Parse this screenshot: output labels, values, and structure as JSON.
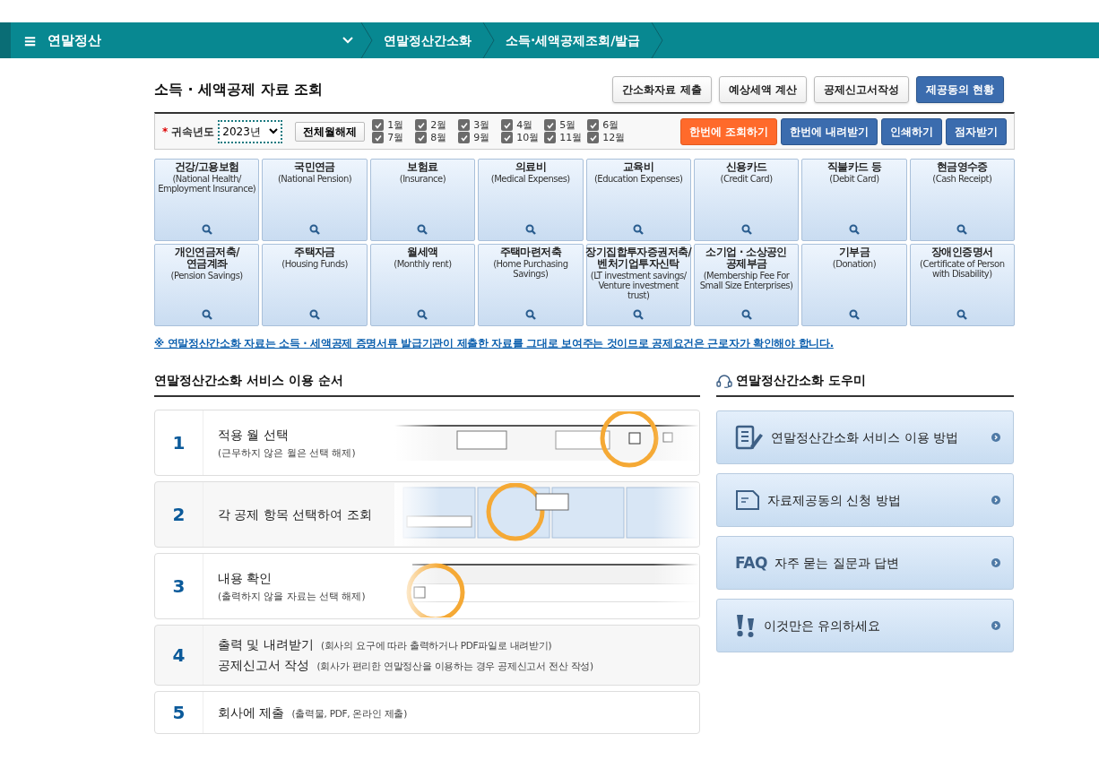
{
  "nav": {
    "menu_icon": "≡",
    "title": "연말정산",
    "crumbs": [
      "연말정산간소화",
      "소득·세액공제조회/발급"
    ]
  },
  "page_title": "소득 · 세액공제 자료 조회",
  "top_buttons": [
    {
      "label": "간소화자료 제출",
      "kind": "plain"
    },
    {
      "label": "예상세액 계산",
      "kind": "plain"
    },
    {
      "label": "공제신고서작성",
      "kind": "plain"
    },
    {
      "label": "제공동의 현황",
      "kind": "primary"
    }
  ],
  "filter": {
    "required_mark": "*",
    "year_label": "귀속년도",
    "year_value": "2023년",
    "clear_button": "전체월해제",
    "months": [
      {
        "label": "1월",
        "checked": true
      },
      {
        "label": "2월",
        "checked": true
      },
      {
        "label": "3월",
        "checked": true
      },
      {
        "label": "4월",
        "checked": true
      },
      {
        "label": "5월",
        "checked": true
      },
      {
        "label": "6월",
        "checked": true
      },
      {
        "label": "7월",
        "checked": true
      },
      {
        "label": "8월",
        "checked": true
      },
      {
        "label": "9월",
        "checked": true
      },
      {
        "label": "10월",
        "checked": true
      },
      {
        "label": "11월",
        "checked": true
      },
      {
        "label": "12월",
        "checked": true
      }
    ],
    "actions": [
      {
        "label": "한번에 조회하기",
        "kind": "accent"
      },
      {
        "label": "한번에 내려받기",
        "kind": "primary"
      },
      {
        "label": "인쇄하기",
        "kind": "primary"
      },
      {
        "label": "점자받기",
        "kind": "primary"
      }
    ]
  },
  "categories": [
    {
      "title": "건강/고용보험",
      "subtitle": "(National Health/ Employment Insurance)"
    },
    {
      "title": "국민연금",
      "subtitle": "(National Pension)"
    },
    {
      "title": "보험료",
      "subtitle": "(Insurance)"
    },
    {
      "title": "의료비",
      "subtitle": "(Medical Expenses)"
    },
    {
      "title": "교육비",
      "subtitle": "(Education Expenses)"
    },
    {
      "title": "신용카드",
      "subtitle": "(Credit Card)"
    },
    {
      "title": "직불카드 등",
      "subtitle": "(Debit Card)"
    },
    {
      "title": "현금영수증",
      "subtitle": "(Cash Receipt)"
    },
    {
      "title": "개인연금저축/ 연금계좌",
      "subtitle": "(Pension Savings)"
    },
    {
      "title": "주택자금",
      "subtitle": "(Housing Funds)"
    },
    {
      "title": "월세액",
      "subtitle": "(Monthly rent)"
    },
    {
      "title": "주택마련저축",
      "subtitle": "(Home Purchasing Savings)"
    },
    {
      "title": "장기집합투자증권저축/ 벤처기업투자신탁",
      "subtitle": "(LT investment savings/ Venture investment trust)"
    },
    {
      "title": "소기업 · 소상공인 공제부금",
      "subtitle": "(Membership Fee For Small Size Enterprises)"
    },
    {
      "title": "기부금",
      "subtitle": "(Donation)"
    },
    {
      "title": "장애인증명서",
      "subtitle": "(Certificate of Person with Disability)"
    }
  ],
  "notice": "※ 연말정산간소화 자료는 소득 · 세액공제 증명서류 발급기관이 제출한 자료를 그대로 보여주는 것이므로 공제요건은 근로자가 확인해야 합니다.",
  "steps_title": "연말정산간소화 서비스 이용 순서",
  "steps": [
    {
      "number": "1",
      "lines": [
        {
          "title": "적용 월 선택"
        }
      ],
      "note": "(근무하지 않은 월은 선택 해제)",
      "illustration": {
        "kind": "picture"
      }
    },
    {
      "number": "2",
      "lines": [
        {
          "title": "각 공제 항목 선택하여 조회"
        }
      ],
      "illustration": {
        "kind": "picture"
      }
    },
    {
      "number": "3",
      "lines": [
        {
          "title": "내용 확인"
        }
      ],
      "note": "(출력하지 않을 자료는 선택 해제)",
      "illustration": {
        "kind": "picture"
      }
    },
    {
      "number": "4",
      "lines": [
        {
          "title": "출력 및 내려받기",
          "aside": "(회사의 요구에 따라 출력하거나 PDF파일로 내려받기)"
        },
        {
          "title": "공제신고서 작성",
          "aside": "(회사가 편리한 연말정산을 이용하는 경우 공제신고서 전산 작성)"
        }
      ]
    },
    {
      "number": "5",
      "lines": [
        {
          "title": "회사에 제출",
          "aside": "(출력물, PDF, 온라인 제출)"
        }
      ]
    }
  ],
  "help_title": "연말정산간소화 도우미",
  "help_items": [
    {
      "label": "연말정산간소화 서비스 이용 방법",
      "kind": "guide"
    },
    {
      "label": "자료제공동의 신청 방법",
      "kind": "document"
    },
    {
      "label": "자주 묻는 질문과 답변",
      "kind": "faq",
      "icon_text": "FAQ"
    },
    {
      "label": "이것만은 유의하세요",
      "kind": "warning"
    }
  ]
}
